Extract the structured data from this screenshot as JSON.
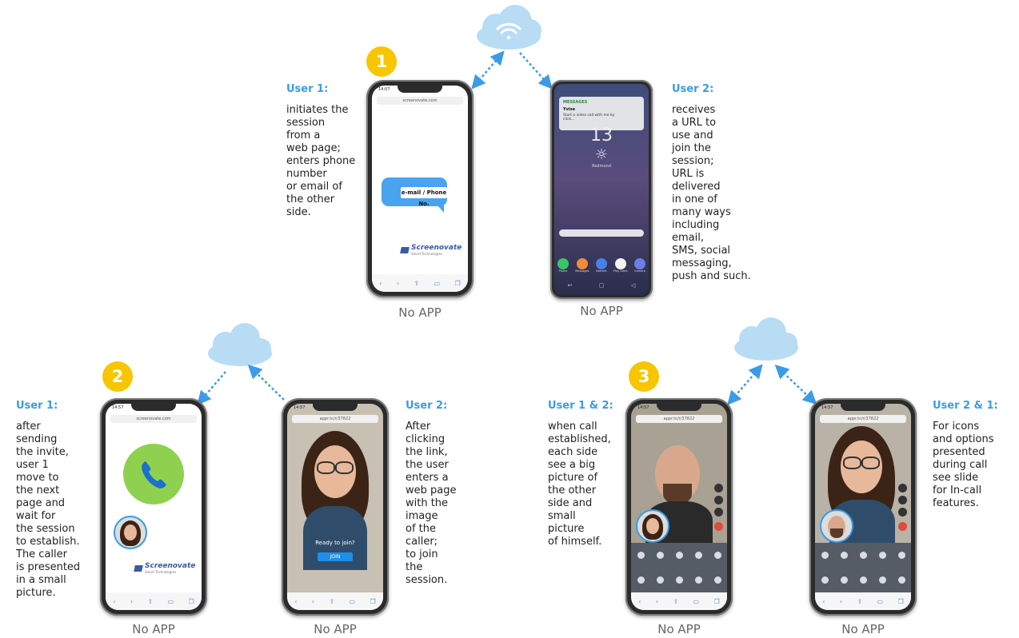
{
  "steps": {
    "one": "1",
    "two": "2",
    "three": "3"
  },
  "common": {
    "no_app": "No APP"
  },
  "section1": {
    "user1_heading": "User 1:",
    "user1_text": "initiates the\nsession\nfrom a\nweb page;\nenters phone\nnumber\nor email of\nthe other\nside.",
    "user2_heading": "User 2:",
    "user2_text": "receives\na URL to\nuse and\njoin the\nsession;\nURL is\ndelivered\nin one of\nmany ways\nincluding\nemail,\nSMS, social\nmessaging,\npush and such.",
    "phone1": {
      "time": "14:07",
      "url": "screenovate.com",
      "bubble": "e-mail / Phone No.",
      "logo": "Screenovate",
      "logo_sub": "Smart Technologies"
    },
    "phone2": {
      "notif_app": "MESSAGES",
      "notif_sender": "Yvise",
      "notif_text": "Start a video call with me by click...",
      "clock": "13",
      "weather": "Redmond",
      "apps": [
        "Phone",
        "Messages",
        "Internet",
        "Play Store",
        "Camera"
      ]
    }
  },
  "section2": {
    "user1_heading": "User 1:",
    "user1_text": "after\nsending\nthe invite,\nuser 1\nmove to\nthe next\npage and\nwait for\nthe session\nto establish.\nThe caller\nis presented\nin a small\npicture.",
    "user2_heading": "User 2:",
    "user2_text": "After\nclicking\nthe link,\nthe user\nenters a\nweb page\nwith the\nimage\nof the\ncaller;\nto join\nthe\nsession.",
    "phone1": {
      "time": "14:57",
      "url": "screenovate.com",
      "logo": "Screenovate",
      "logo_sub": "Smart Technologies"
    },
    "phone2": {
      "time": "14:57",
      "url": "appr.tc/r/37822",
      "ready": "Ready to join?",
      "join": "JOIN"
    }
  },
  "section3": {
    "user12_heading": "User 1 & 2:",
    "user12_text": "when call\nestablished,\neach side\nsee a big\npicture of\nthe other\nside and\nsmall\npicture\nof himself.",
    "user21_heading": "User 2 & 1:",
    "user21_text": "For icons\nand options\npresented\nduring call\nsee slide\nfor In-call\nfeatures.",
    "phone1": {
      "time": "14:57",
      "url": "appr.tc/r/37822"
    },
    "phone2": {
      "time": "14:57",
      "url": "appr.tc/r/37822"
    }
  },
  "colors": {
    "accent": "#3b9be8",
    "badge": "#f7c600",
    "cloud": "#b9dcf5",
    "call_green": "#8ed14f"
  },
  "icons": [
    "cloud-icon",
    "wifi-icon",
    "phone-handset-icon",
    "sun-icon"
  ]
}
